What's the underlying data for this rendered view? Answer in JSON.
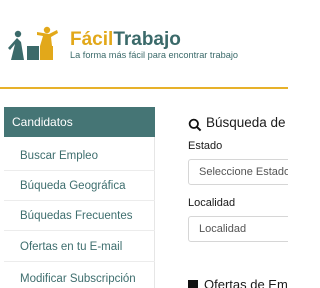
{
  "header": {
    "brand_part1": "Fácil",
    "brand_part2": "Trabajo",
    "tagline": "La forma más fácil para encontrar trabajo",
    "colors": {
      "brand_yellow": "#e2a81a",
      "brand_teal": "#3b6a6a"
    }
  },
  "sidebar": {
    "header": "Candidatos",
    "items": [
      {
        "label": "Buscar Empleo"
      },
      {
        "label": "Búqueda Geográfica"
      },
      {
        "label": "Búquedas Frecuentes"
      },
      {
        "label": "Ofertas en tu E-mail"
      },
      {
        "label": "Modificar Subscripción"
      }
    ]
  },
  "search": {
    "icon": "search-icon",
    "title": "Búsqueda de C",
    "estado": {
      "label": "Estado",
      "placeholder": "Seleccione Estado"
    },
    "localidad": {
      "label": "Localidad",
      "placeholder": "Localidad"
    }
  },
  "offers": {
    "title": "Ofertas de Em"
  }
}
